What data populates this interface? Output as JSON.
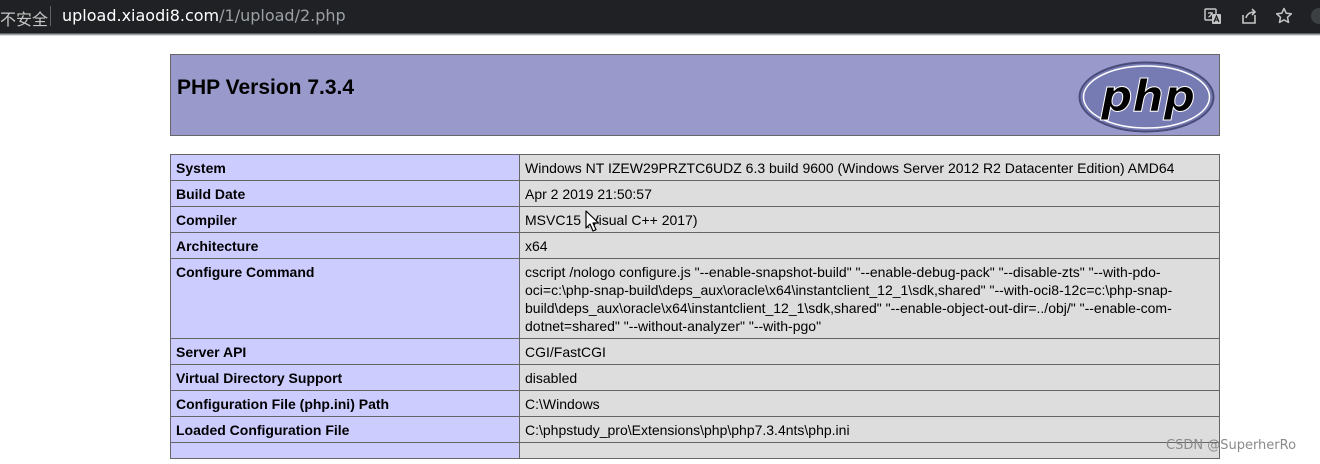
{
  "browser": {
    "security_label": "不安全",
    "url_host": "upload.xiaodi8.com",
    "url_path": "/1/upload/2.php",
    "icons": [
      "translate-icon",
      "share-icon",
      "bookmark-star-icon",
      "profile-icon"
    ]
  },
  "header": {
    "title": "PHP Version 7.3.4",
    "logo_text": "php",
    "bg_color": "#9999cc"
  },
  "info_rows": [
    {
      "key": "System",
      "value": "Windows NT IZEW29PRZTC6UDZ 6.3 build 9600 (Windows Server 2012 R2 Datacenter Edition) AMD64"
    },
    {
      "key": "Build Date",
      "value": "Apr 2 2019 21:50:57"
    },
    {
      "key": "Compiler",
      "value": "MSVC15 (Visual C++ 2017)"
    },
    {
      "key": "Architecture",
      "value": "x64"
    },
    {
      "key": "Configure Command",
      "value": "cscript /nologo configure.js \"--enable-snapshot-build\" \"--enable-debug-pack\" \"--disable-zts\" \"--with-pdo-oci=c:\\php-snap-build\\deps_aux\\oracle\\x64\\instantclient_12_1\\sdk,shared\" \"--with-oci8-12c=c:\\php-snap-build\\deps_aux\\oracle\\x64\\instantclient_12_1\\sdk,shared\" \"--enable-object-out-dir=../obj/\" \"--enable-com-dotnet=shared\" \"--without-analyzer\" \"--with-pgo\""
    },
    {
      "key": "Server API",
      "value": "CGI/FastCGI"
    },
    {
      "key": "Virtual Directory Support",
      "value": "disabled"
    },
    {
      "key": "Configuration File (php.ini) Path",
      "value": "C:\\Windows"
    },
    {
      "key": "Loaded Configuration File",
      "value": "C:\\phpstudy_pro\\Extensions\\php\\php7.3.4nts\\php.ini"
    }
  ],
  "colors": {
    "key_cell": "#ccccff",
    "value_cell": "#dddddd",
    "border": "#666666"
  },
  "watermark": "CSDN @SuperherRo"
}
